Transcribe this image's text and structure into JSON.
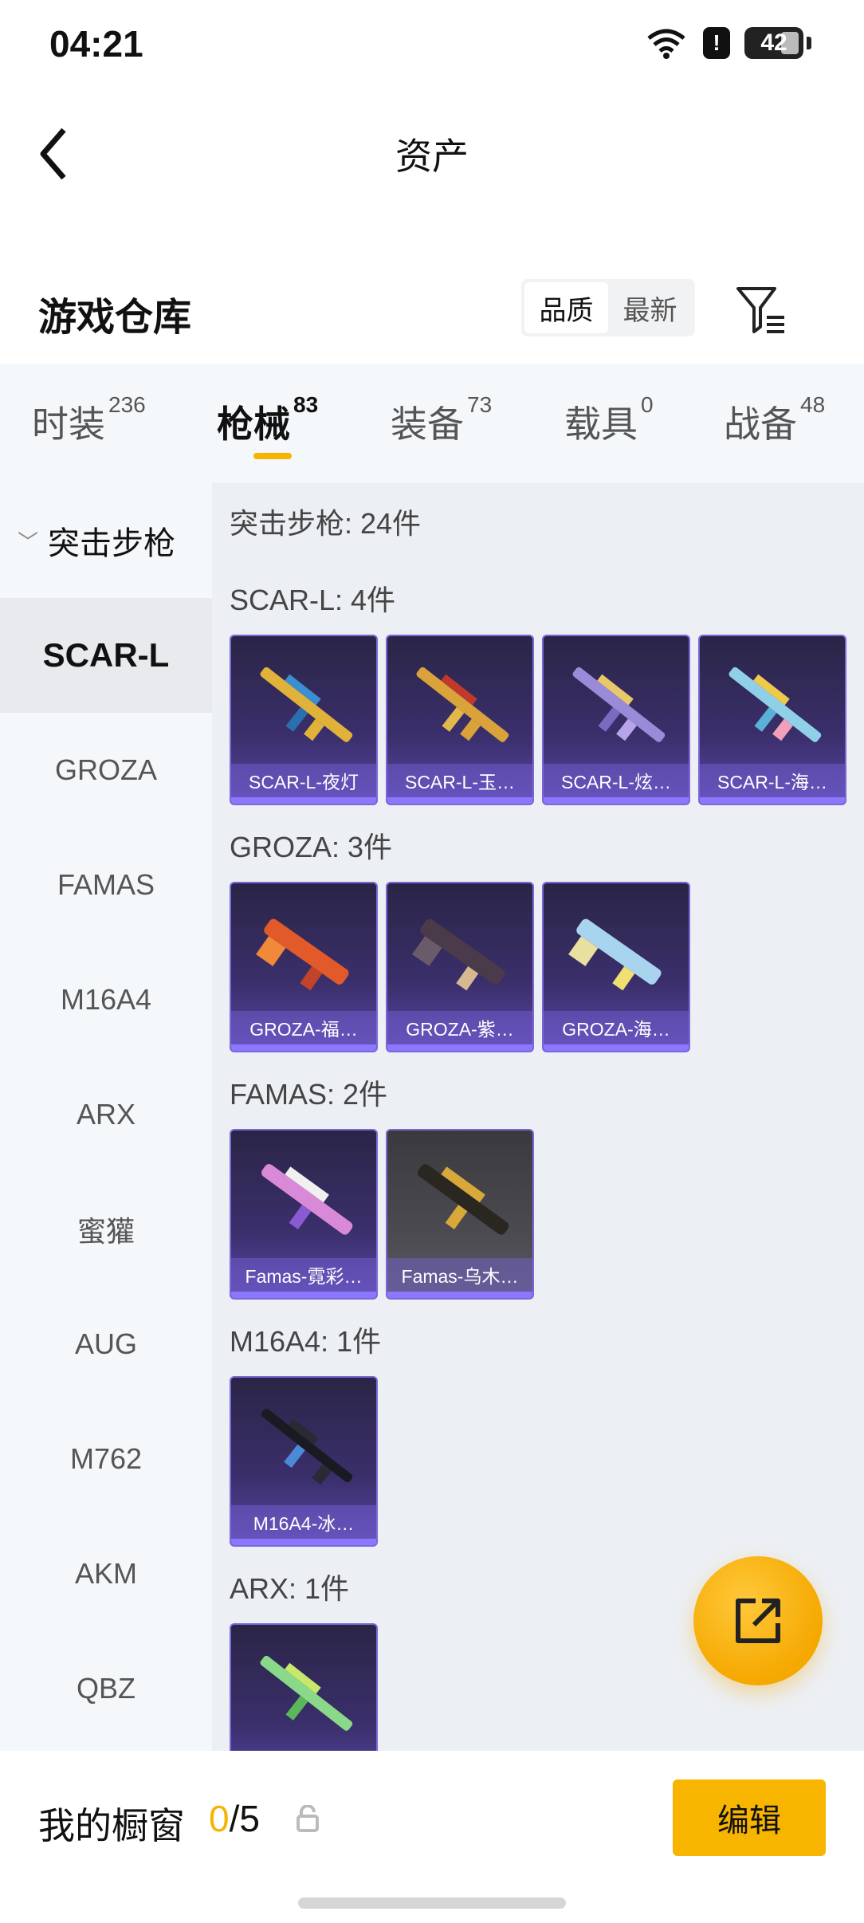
{
  "status": {
    "time": "04:21",
    "alert": "!",
    "battery": "42"
  },
  "nav": {
    "title": "资产"
  },
  "warehouse": {
    "title": "游戏仓库",
    "sort_options": [
      "品质",
      "最新"
    ],
    "sort_active": "品质"
  },
  "tabs": [
    {
      "label": "时装",
      "count": "236"
    },
    {
      "label": "枪械",
      "count": "83"
    },
    {
      "label": "装备",
      "count": "73"
    },
    {
      "label": "载具",
      "count": "0"
    },
    {
      "label": "战备",
      "count": "48"
    }
  ],
  "sidebar": {
    "group": "突击步枪",
    "items": [
      "SCAR-L",
      "GROZA",
      "FAMAS",
      "M16A4",
      "ARX",
      "蜜獾",
      "AUG",
      "M762",
      "AKM",
      "QBZ"
    ]
  },
  "content": {
    "header": "突击步枪: 24件",
    "groups": [
      {
        "title": "SCAR-L: 4件",
        "items": [
          "SCAR-L-夜灯",
          "SCAR-L-玉…",
          "SCAR-L-炫…",
          "SCAR-L-海…"
        ]
      },
      {
        "title": "GROZA: 3件",
        "items": [
          "GROZA-福…",
          "GROZA-紫…",
          "GROZA-海…"
        ]
      },
      {
        "title": "FAMAS: 2件",
        "items": [
          "Famas-霓彩…",
          "Famas-乌木…"
        ]
      },
      {
        "title": "M16A4: 1件",
        "items": [
          "M16A4-冰…"
        ]
      },
      {
        "title": "ARX: 1件",
        "items": []
      }
    ]
  },
  "bottom": {
    "showcase_label": "我的橱窗",
    "showcase_current": "0",
    "showcase_sep": "/5",
    "edit_label": "编辑"
  },
  "colors": {
    "accent": "#f5b400",
    "card_border": "#7b67d8",
    "card_bg": "#3b2f6c"
  },
  "icons": [
    "back-arrow-icon",
    "filter-icon",
    "wifi-icon",
    "share-icon",
    "lock-icon"
  ]
}
